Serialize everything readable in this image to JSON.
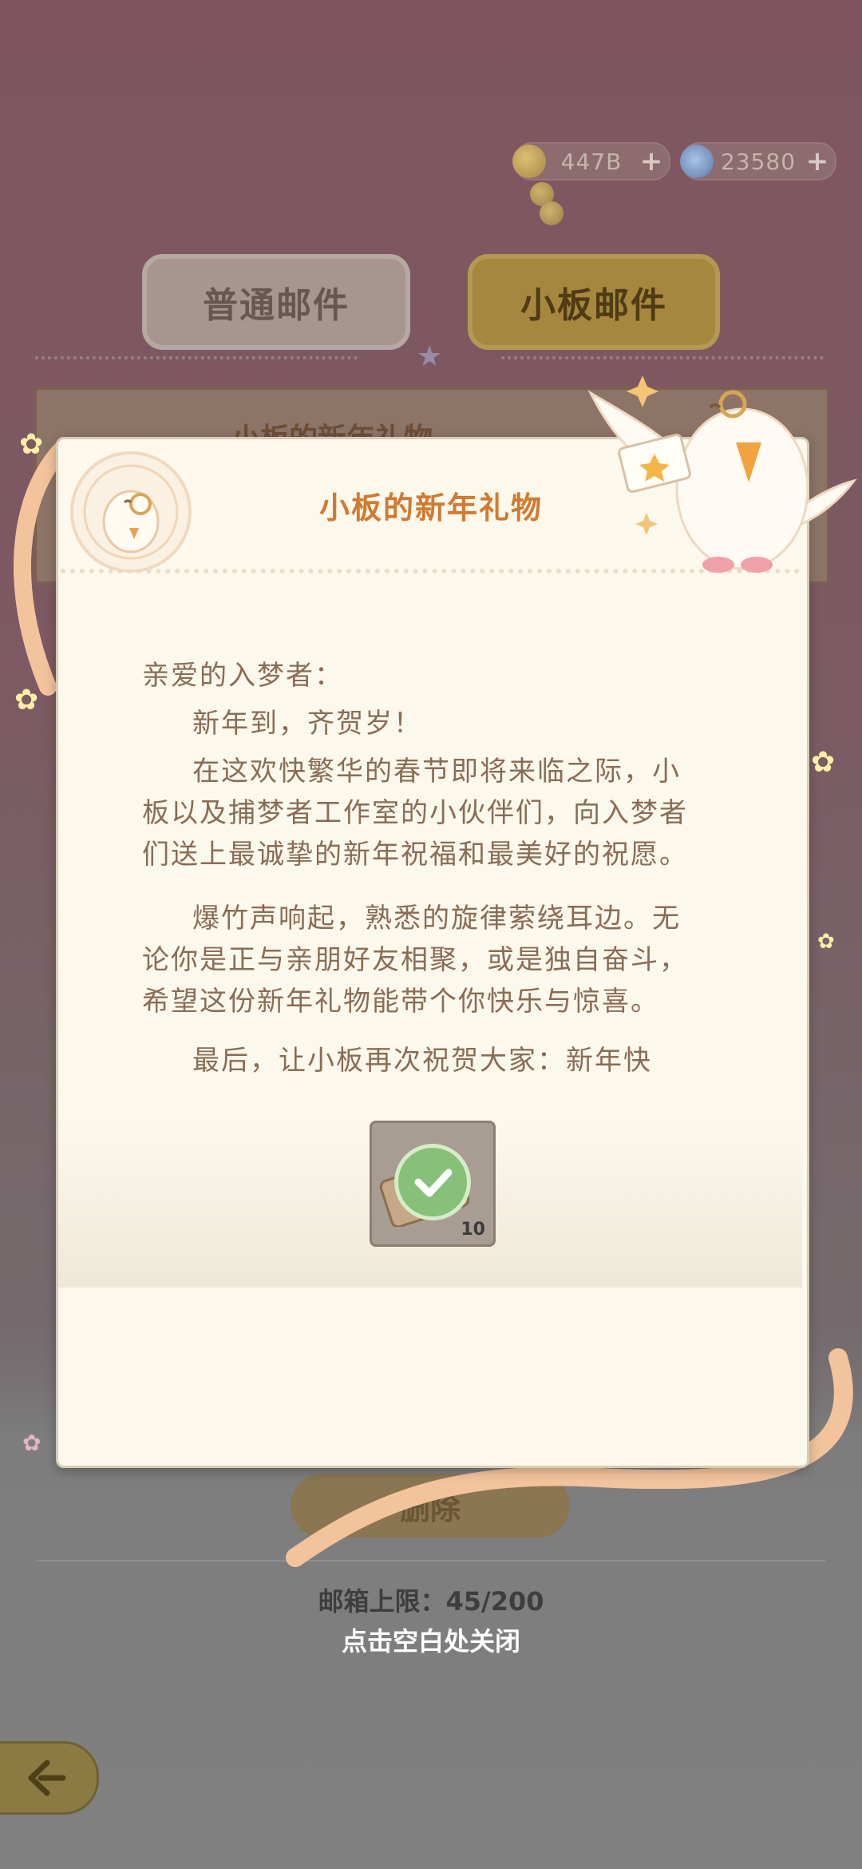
{
  "header": {
    "currencies": [
      {
        "name": "coins",
        "value": "447B",
        "plus": "+"
      },
      {
        "name": "gems",
        "value": "23580",
        "plus": "+"
      }
    ]
  },
  "tabs": [
    {
      "label": "普通邮件",
      "active": false
    },
    {
      "label": "小板邮件",
      "active": true
    }
  ],
  "mail_list": {
    "first_item_title": "小板的新年礼物"
  },
  "letter": {
    "title": "小板的新年礼物",
    "greeting": "亲爱的入梦者：",
    "paragraphs": [
      "新年到，齐贺岁！",
      "在这欢快繁华的春节即将来临之际，小板以及捕梦者工作室的小伙伴们，向入梦者们送上最诚挚的新年祝福和最美好的祝愿。",
      "爆竹声响起，熟悉的旋律萦绕耳边。无论你是正与亲朋好友相聚，或是独自奋斗，希望这份新年礼物能带个你快乐与惊喜。",
      "最后，让小板再次祝贺大家：新年快"
    ],
    "attachment": {
      "count": "10",
      "claimed": true
    }
  },
  "footer": {
    "delete_label": "删除",
    "mailbox_limit": "邮箱上限：45/200",
    "close_hint": "点击空白处关闭"
  },
  "colors": {
    "title_orange": "#d07a31",
    "body_brown": "#8a6c55",
    "letter_bg": "#fcf8ec",
    "check_green": "#86c079"
  }
}
